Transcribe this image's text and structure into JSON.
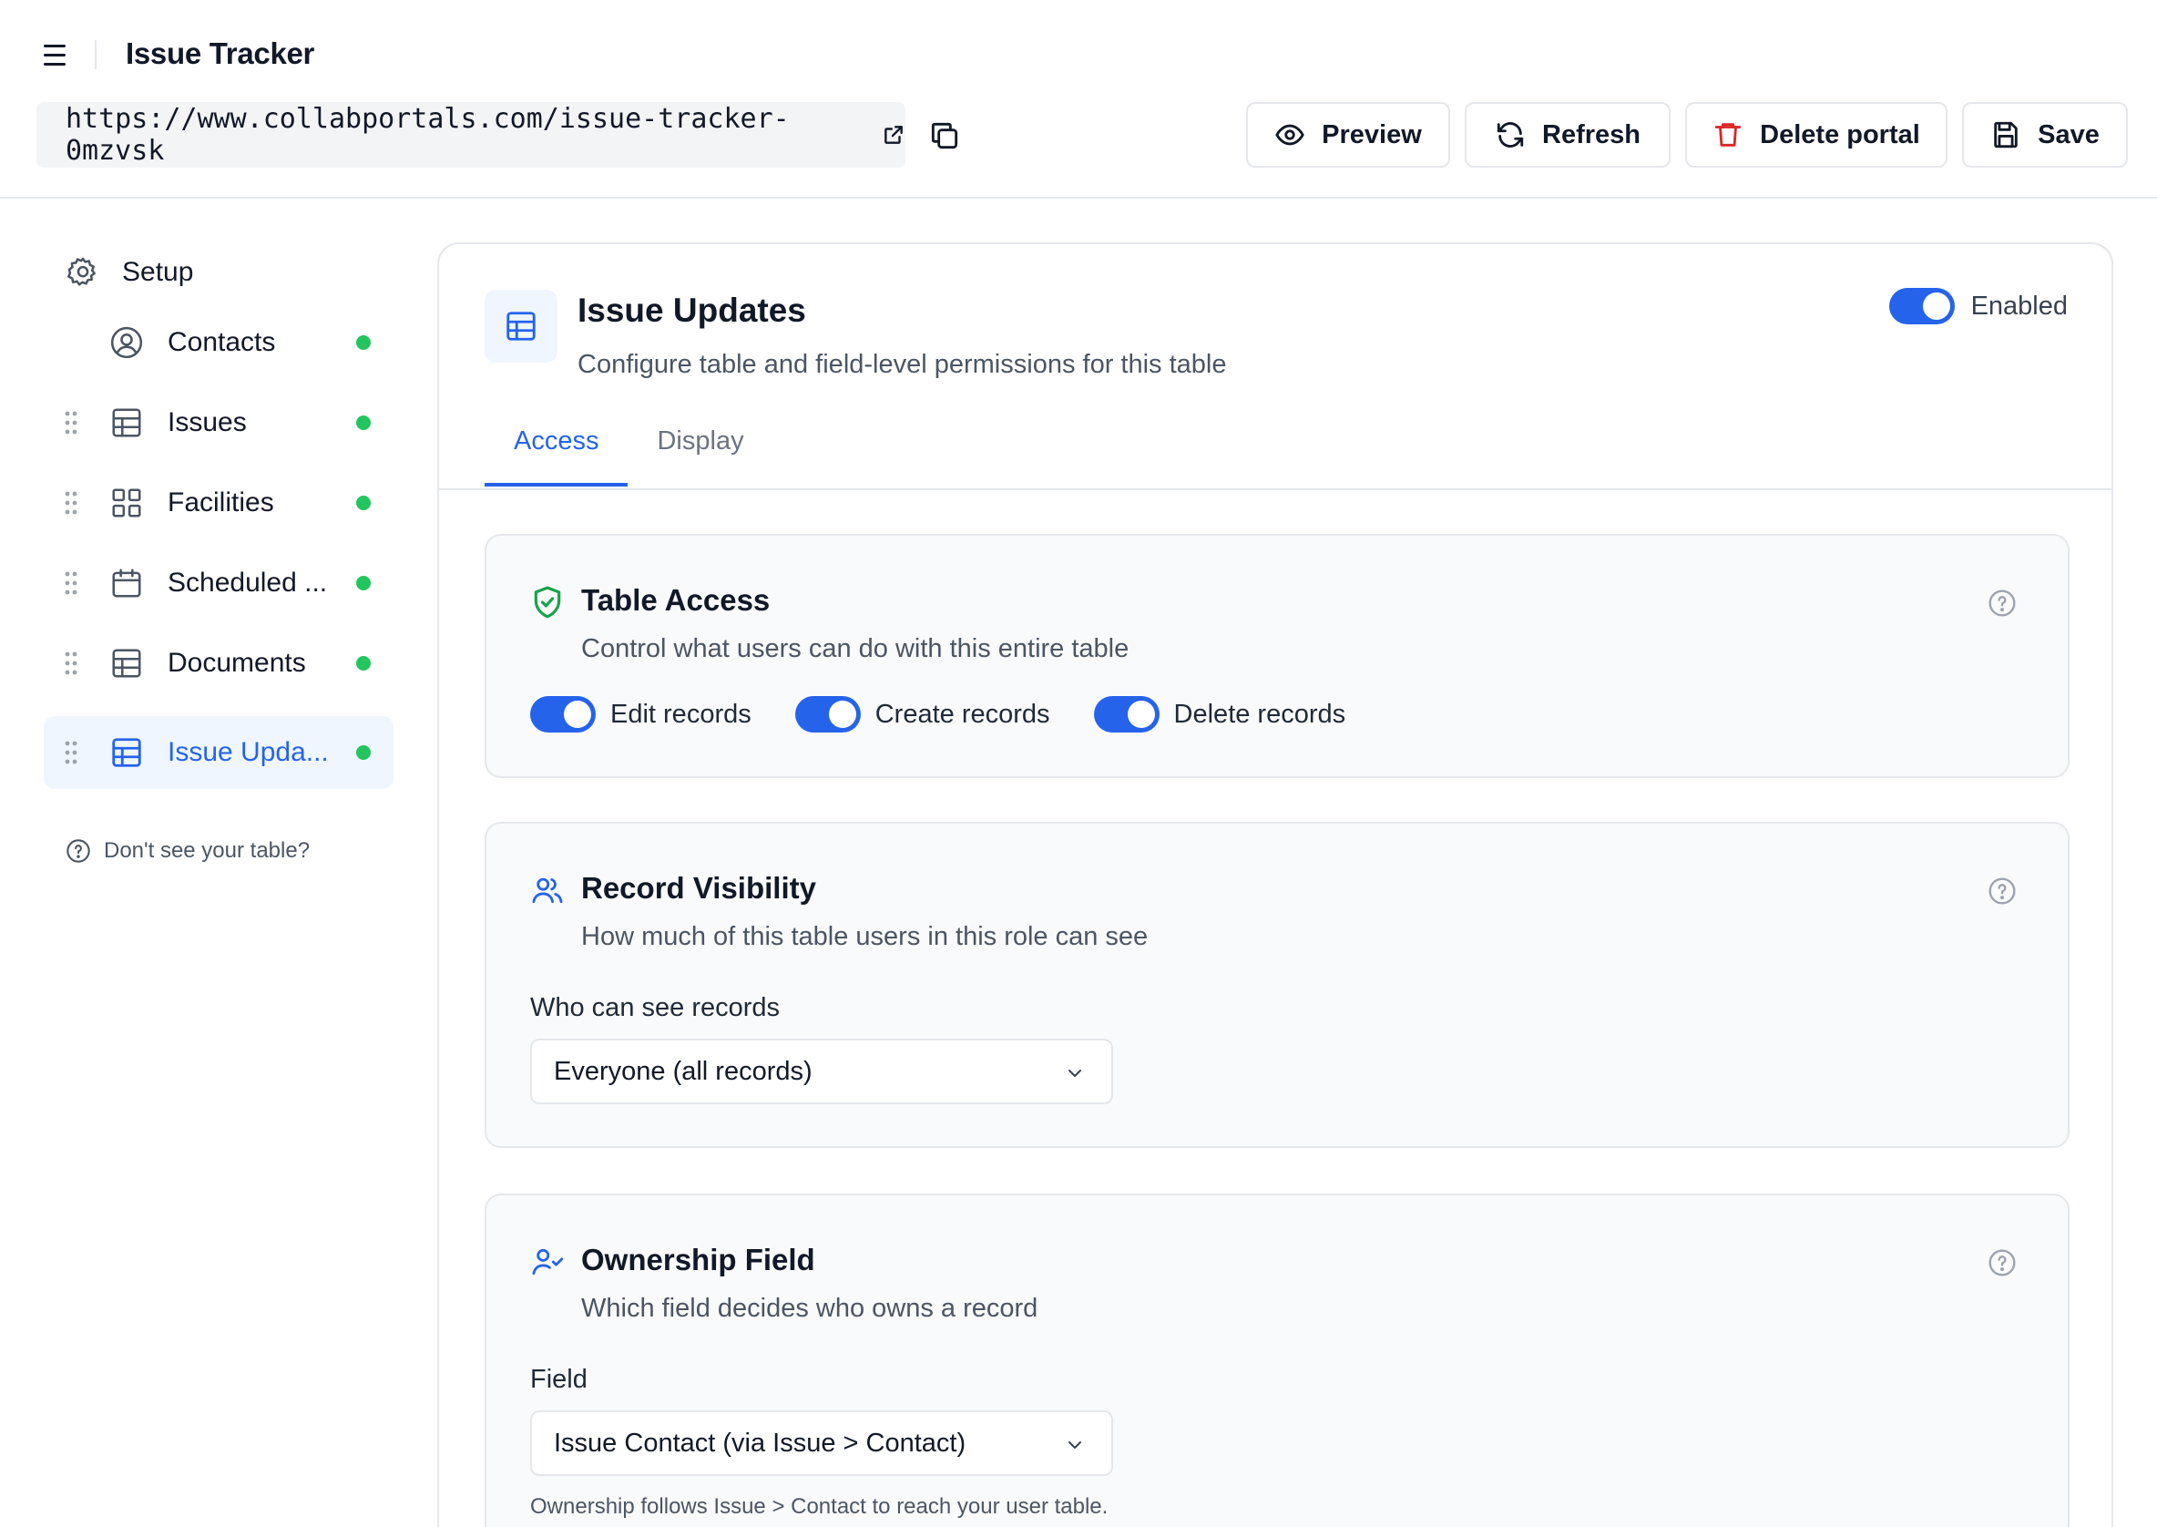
{
  "app": {
    "title": "Issue Tracker"
  },
  "header": {
    "url": "https://www.collabportals.com/issue-tracker-0mzvsk",
    "buttons": {
      "preview": "Preview",
      "refresh": "Refresh",
      "delete": "Delete portal",
      "save": "Save"
    }
  },
  "sidebar": {
    "setup": "Setup",
    "items": [
      {
        "label": "Contacts",
        "icon": "user-circle-icon",
        "status": "active"
      },
      {
        "label": "Issues",
        "icon": "table-icon",
        "status": "active"
      },
      {
        "label": "Facilities",
        "icon": "grid-icon",
        "status": "active"
      },
      {
        "label": "Scheduled ...",
        "icon": "calendar-icon",
        "status": "active"
      },
      {
        "label": "Documents",
        "icon": "table-icon",
        "status": "active"
      },
      {
        "label": "Issue Upda...",
        "icon": "table-icon",
        "status": "active",
        "selected": true
      }
    ],
    "help": "Don't see your table?"
  },
  "panel": {
    "title": "Issue Updates",
    "subtitle": "Configure table and field-level permissions for this table",
    "enabled_label": "Enabled",
    "enabled": true,
    "tabs": [
      {
        "label": "Access",
        "active": true
      },
      {
        "label": "Display",
        "active": false
      }
    ],
    "table_access": {
      "title": "Table Access",
      "subtitle": "Control what users can do with this entire table",
      "toggles": [
        {
          "label": "Edit records",
          "on": true
        },
        {
          "label": "Create records",
          "on": true
        },
        {
          "label": "Delete records",
          "on": true
        }
      ]
    },
    "record_visibility": {
      "title": "Record Visibility",
      "subtitle": "How much of this table users in this role can see",
      "field_label": "Who can see records",
      "value": "Everyone (all records)"
    },
    "ownership": {
      "title": "Ownership Field",
      "subtitle": "Which field decides who owns a record",
      "field_label": "Field",
      "value": "Issue Contact (via Issue > Contact)",
      "hint": "Ownership follows Issue > Contact to reach your user table."
    }
  },
  "colors": {
    "accent": "#2563eb",
    "status_green": "#22c55e",
    "danger": "#dc2626",
    "success_icon": "#16a34a"
  }
}
